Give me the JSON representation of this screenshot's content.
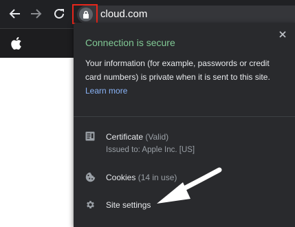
{
  "address_bar": {
    "url": "cloud.com"
  },
  "icons": {
    "back": "back-arrow-icon",
    "forward": "forward-arrow-icon",
    "reload": "reload-icon",
    "lock": "lock-icon",
    "apple": "apple-logo-icon",
    "close": "close-icon",
    "certificate": "certificate-icon",
    "cookies": "cookie-icon",
    "site_settings": "gear-icon",
    "annotation": "pointer-arrow-icon"
  },
  "popup": {
    "title": "Connection is secure",
    "description": "Your information (for example, passwords or credit card numbers) is private when it is sent to this site.",
    "learn_more": "Learn more",
    "certificate": {
      "label": "Certificate",
      "status": "(Valid)",
      "detail": "Issued to: Apple Inc. [US]"
    },
    "cookies": {
      "label": "Cookies",
      "count": "(14 in use)"
    },
    "site_settings": {
      "label": "Site settings"
    }
  },
  "colors": {
    "secure_green": "#81c995",
    "link_blue": "#8ab4f8",
    "highlight_red": "#e8261b",
    "popup_bg": "#292a2d",
    "toolbar_bg": "#202124"
  }
}
